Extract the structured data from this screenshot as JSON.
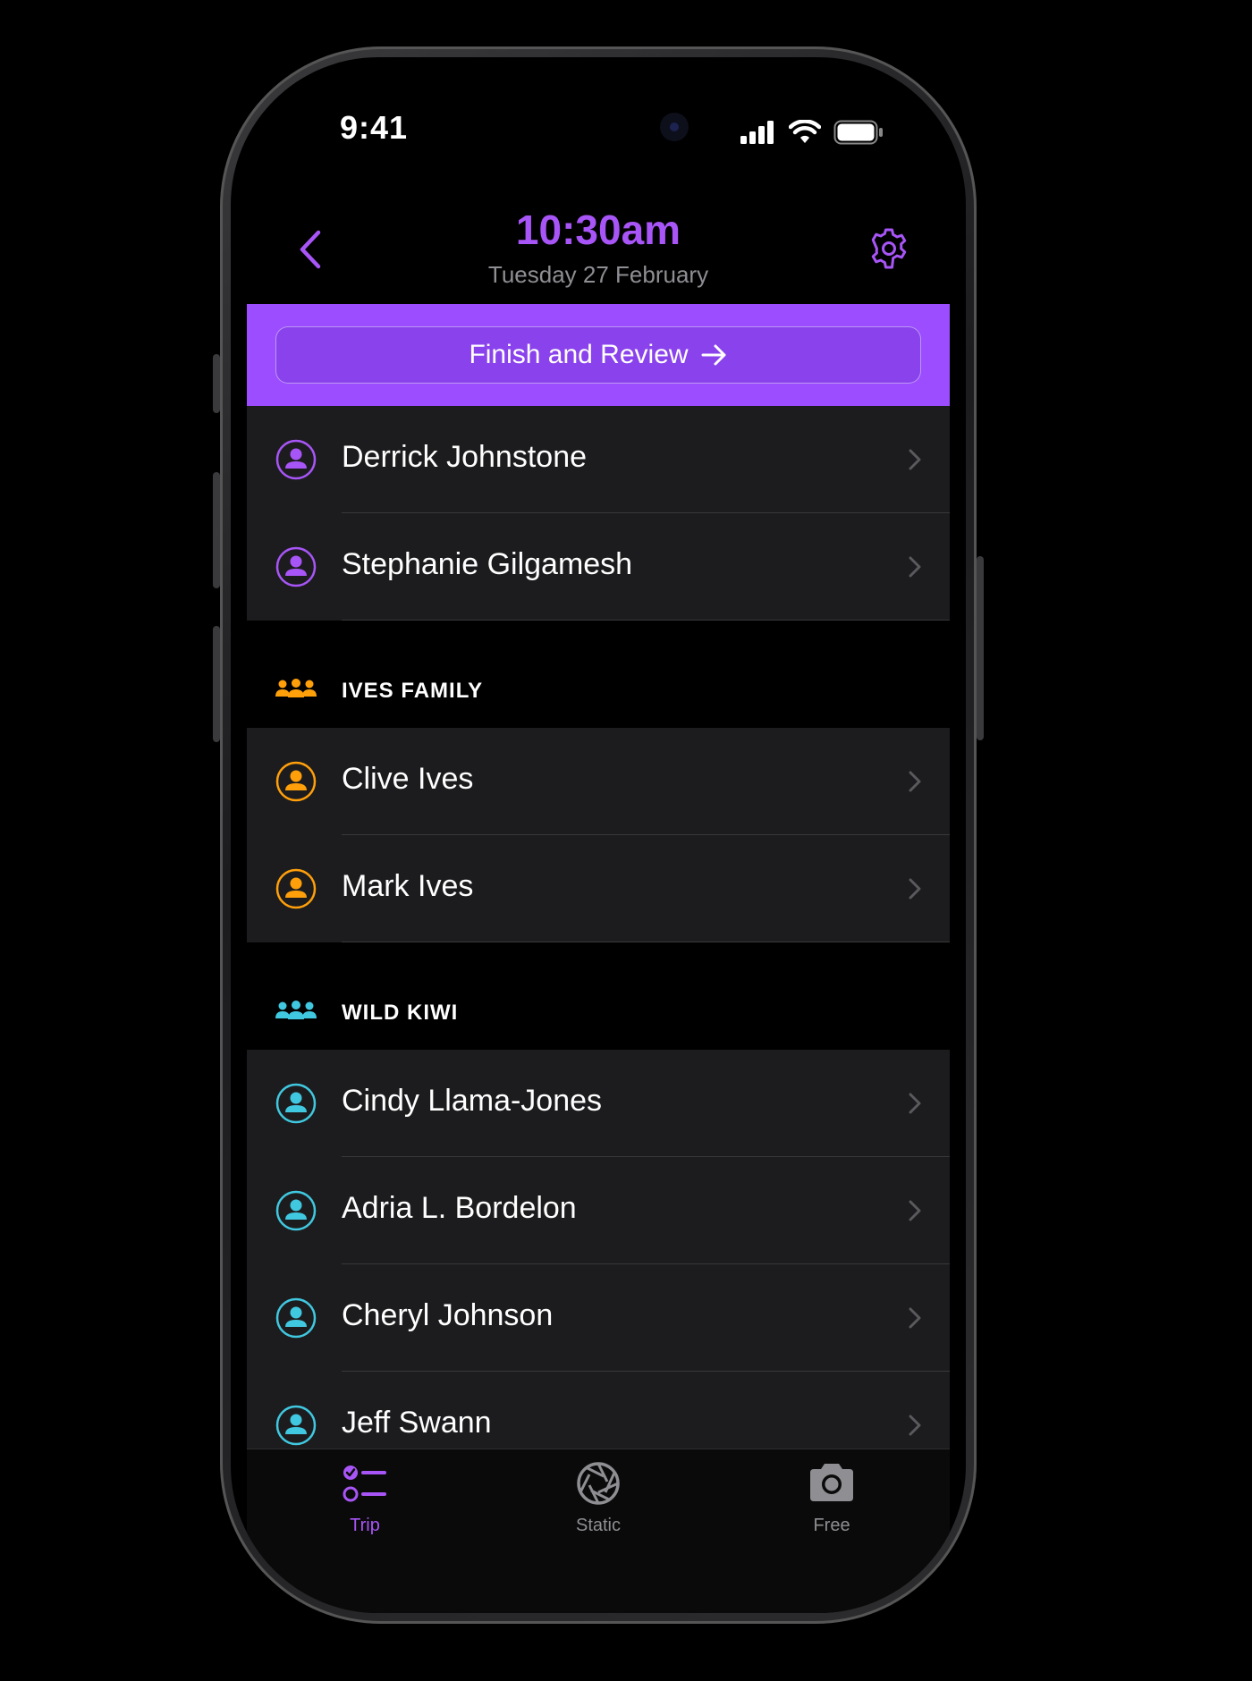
{
  "status_bar": {
    "time": "9:41"
  },
  "nav": {
    "title": "10:30am",
    "subtitle": "Tuesday 27 February"
  },
  "banner": {
    "button_label": "Finish and Review"
  },
  "colors": {
    "accent": "#a855f7",
    "banner": "#9b4dff",
    "ives": "#ff9f0a",
    "kiwi": "#40c8e0"
  },
  "groups": [
    {
      "title": "",
      "color": "#a855f7",
      "members": [
        "Derrick Johnstone",
        "Stephanie Gilgamesh"
      ]
    },
    {
      "title": "IVES FAMILY",
      "color": "#ff9f0a",
      "members": [
        "Clive Ives",
        "Mark Ives"
      ]
    },
    {
      "title": "WILD KIWI",
      "color": "#40c8e0",
      "members": [
        "Cindy Llama-Jones",
        "Adria L. Bordelon",
        "Cheryl Johnson",
        "Jeff Swann"
      ]
    }
  ],
  "tabs": [
    {
      "label": "Trip",
      "icon": "checklist-icon",
      "active": true
    },
    {
      "label": "Static",
      "icon": "aperture-icon",
      "active": false
    },
    {
      "label": "Free",
      "icon": "camera-icon",
      "active": false
    }
  ]
}
